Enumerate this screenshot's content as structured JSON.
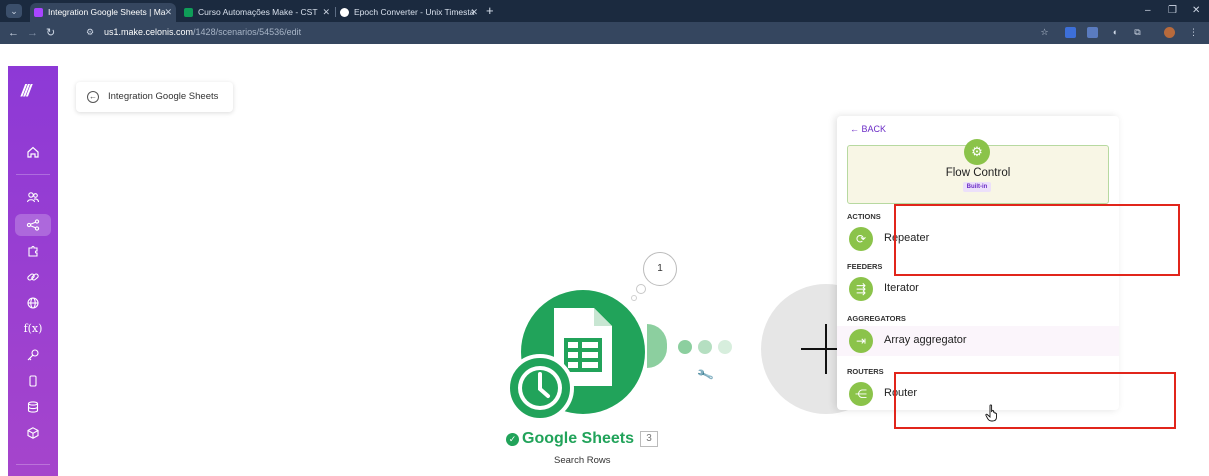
{
  "browser": {
    "tabs": [
      {
        "title": "Integration Google Sheets | Ma",
        "active": true,
        "favicon_color": "#a945ff"
      },
      {
        "title": "Curso Automações Make - CST",
        "active": false,
        "favicon_color": "#0f9d58"
      },
      {
        "title": "Epoch Converter - Unix Timesta",
        "active": false,
        "favicon_color": "#ffffff"
      }
    ],
    "new_tab": "+",
    "url_host": "us1.make.celonis.com",
    "url_path": "/1428/scenarios/54536/edit"
  },
  "scenario": {
    "name": "Integration Google Sheets"
  },
  "module": {
    "app_name": "Google Sheets",
    "operation_count": "3",
    "operation": "Search Rows",
    "bubble_number": "1"
  },
  "panel": {
    "back_label": "← BACK",
    "selected": {
      "name": "Flow Control",
      "badge": "Built-in"
    },
    "sections": [
      {
        "heading": "ACTIONS",
        "items": [
          {
            "label": "Repeater",
            "icon": "repeat-icon"
          }
        ]
      },
      {
        "heading": "FEEDERS",
        "items": [
          {
            "label": "Iterator",
            "icon": "iterator-icon"
          }
        ]
      },
      {
        "heading": "AGGREGATORS",
        "items": [
          {
            "label": "Array aggregator",
            "icon": "aggregator-icon"
          }
        ]
      },
      {
        "heading": "ROUTERS",
        "items": [
          {
            "label": "Router",
            "icon": "router-icon"
          }
        ]
      }
    ]
  },
  "colors": {
    "make_purple": "#9a3fd2",
    "sheets_green": "#21a35a",
    "flow_green": "#8bc34a",
    "highlight_red": "#e1251b"
  }
}
